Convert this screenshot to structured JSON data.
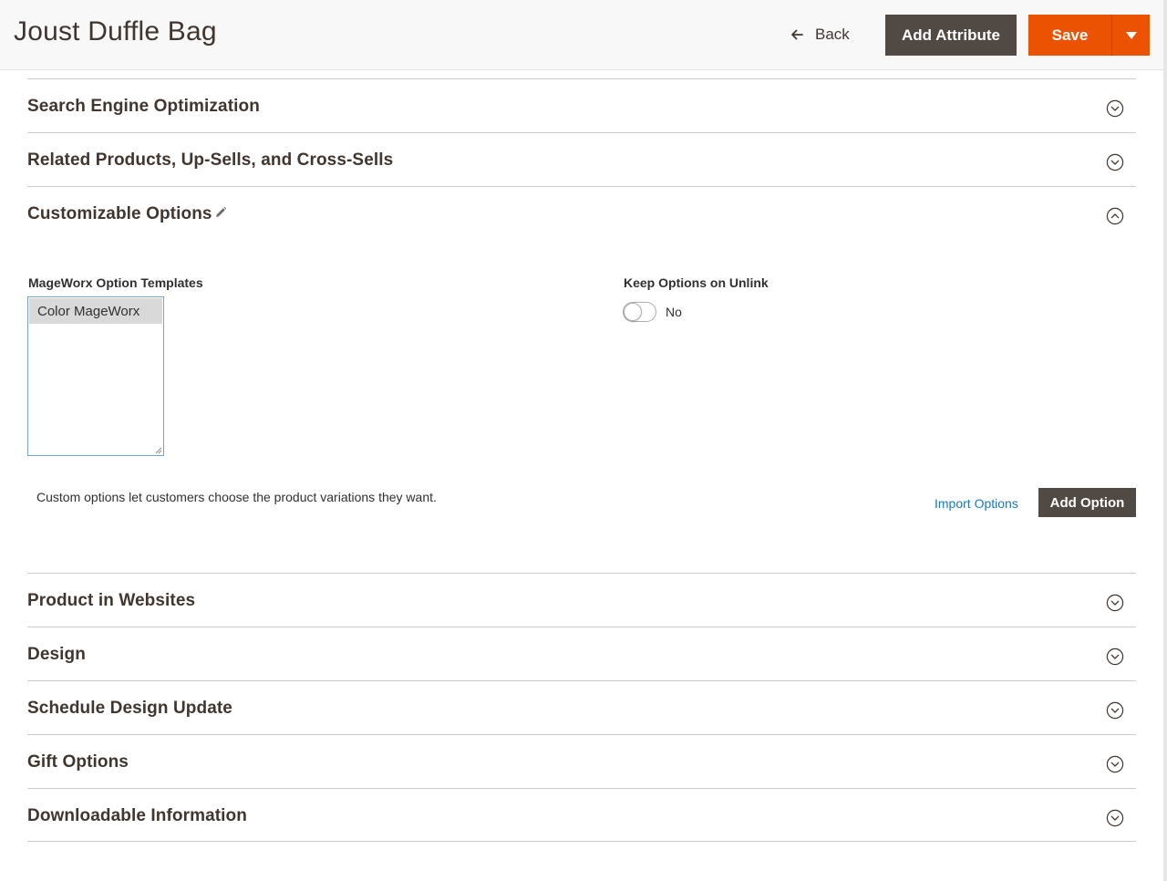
{
  "header": {
    "title": "Joust Duffle Bag",
    "back_label": "Back",
    "add_attribute_label": "Add Attribute",
    "save_label": "Save"
  },
  "sections": {
    "seo": "Search Engine Optimization",
    "related": "Related Products, Up-Sells, and Cross-Sells",
    "customizable": "Customizable Options",
    "websites": "Product in Websites",
    "design": "Design",
    "schedule": "Schedule Design Update",
    "gift": "Gift Options",
    "downloadable": "Downloadable Information"
  },
  "customizable": {
    "templates_label": "MageWorx Option Templates",
    "template_options": [
      "Color MageWorx"
    ],
    "keep_options_label": "Keep Options on Unlink",
    "keep_options_value": "No",
    "keep_options_on": false,
    "help_text": "Custom options let customers choose the product variations they want.",
    "import_label": "Import Options",
    "add_option_label": "Add Option"
  },
  "colors": {
    "accent": "#eb5202",
    "dark_button": "#514943",
    "link": "#1979c3"
  },
  "icons": {
    "back": "arrow-left-icon",
    "save_dropdown": "caret-down-icon",
    "section_collapsed": "chevron-down-circle-icon",
    "section_expanded": "chevron-up-circle-icon",
    "edit": "pencil-icon"
  }
}
